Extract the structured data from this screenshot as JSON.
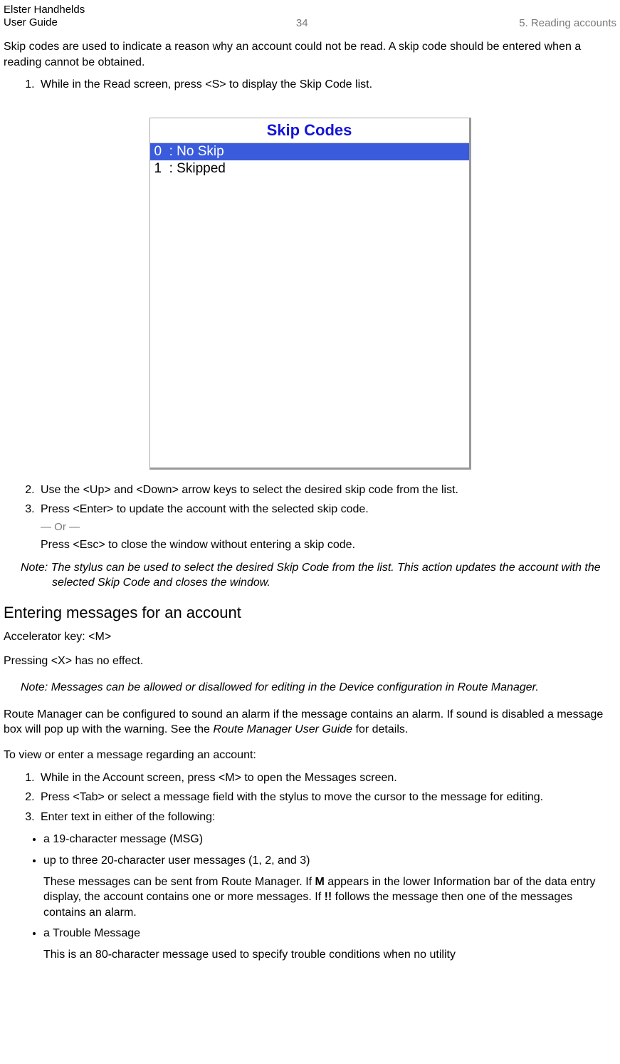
{
  "header": {
    "line1": "Elster Handhelds",
    "line2": "User Guide",
    "page_number": "34",
    "chapter": "5. Reading accounts"
  },
  "intro": "Skip codes are used to indicate a reason why an account could not be read. A skip code should be entered when a reading cannot be obtained.",
  "steps_a": {
    "s1": "While in the Read screen, press <S> to display the Skip Code list.",
    "s2": "Use the <Up> and <Down> arrow keys to select the desired skip code from the list.",
    "s3": "Press <Enter> to update the account with the selected skip code.",
    "or": "— Or —",
    "s3b": "Press <Esc> to close the window without entering a skip code."
  },
  "screenshot": {
    "title": "Skip Codes",
    "item0": "0  : No Skip",
    "item1": "1  : Skipped"
  },
  "note1": "Note: The stylus can be used to select the desired Skip Code from the list. This action updates the account with the selected Skip Code and closes the window.",
  "section_heading": "Entering messages for an account",
  "accel": "Accelerator key: <M>",
  "noeffect": "Pressing <X> has no effect.",
  "note2": "Note: Messages can be allowed or disallowed for editing in the Device configuration in Route Manager.",
  "rm_para_a": "Route Manager can be configured to sound an alarm if the message contains an alarm. If sound is disabled a message box will pop up with the warning. See the ",
  "rm_para_i": "Route Manager User Guide",
  "rm_para_b": " for details.",
  "viewenter": "To view or enter a message regarding an account:",
  "steps_b": {
    "s1": "While in the Account screen, press <M> to open the Messages screen.",
    "s2": "Press <Tab> or select a message field with the stylus to move the cursor to the message for editing.",
    "s3": "Enter text in either of the following:"
  },
  "bullets": {
    "b1": "a 19-character message (MSG)",
    "b2": "up to three 20-character user messages (1, 2, and 3)",
    "b2_sub_a": "These messages can be sent from Route Manager. If ",
    "b2_sub_m": "M",
    "b2_sub_b": " appears in the lower Information bar of the data entry display, the account contains one or more messages. If ",
    "b2_sub_bang": "!!",
    "b2_sub_c": " follows the message then one of the messages contains an alarm.",
    "b3": "a Trouble Message",
    "b3_sub": "This is an 80-character message used to specify trouble conditions when no utility"
  }
}
